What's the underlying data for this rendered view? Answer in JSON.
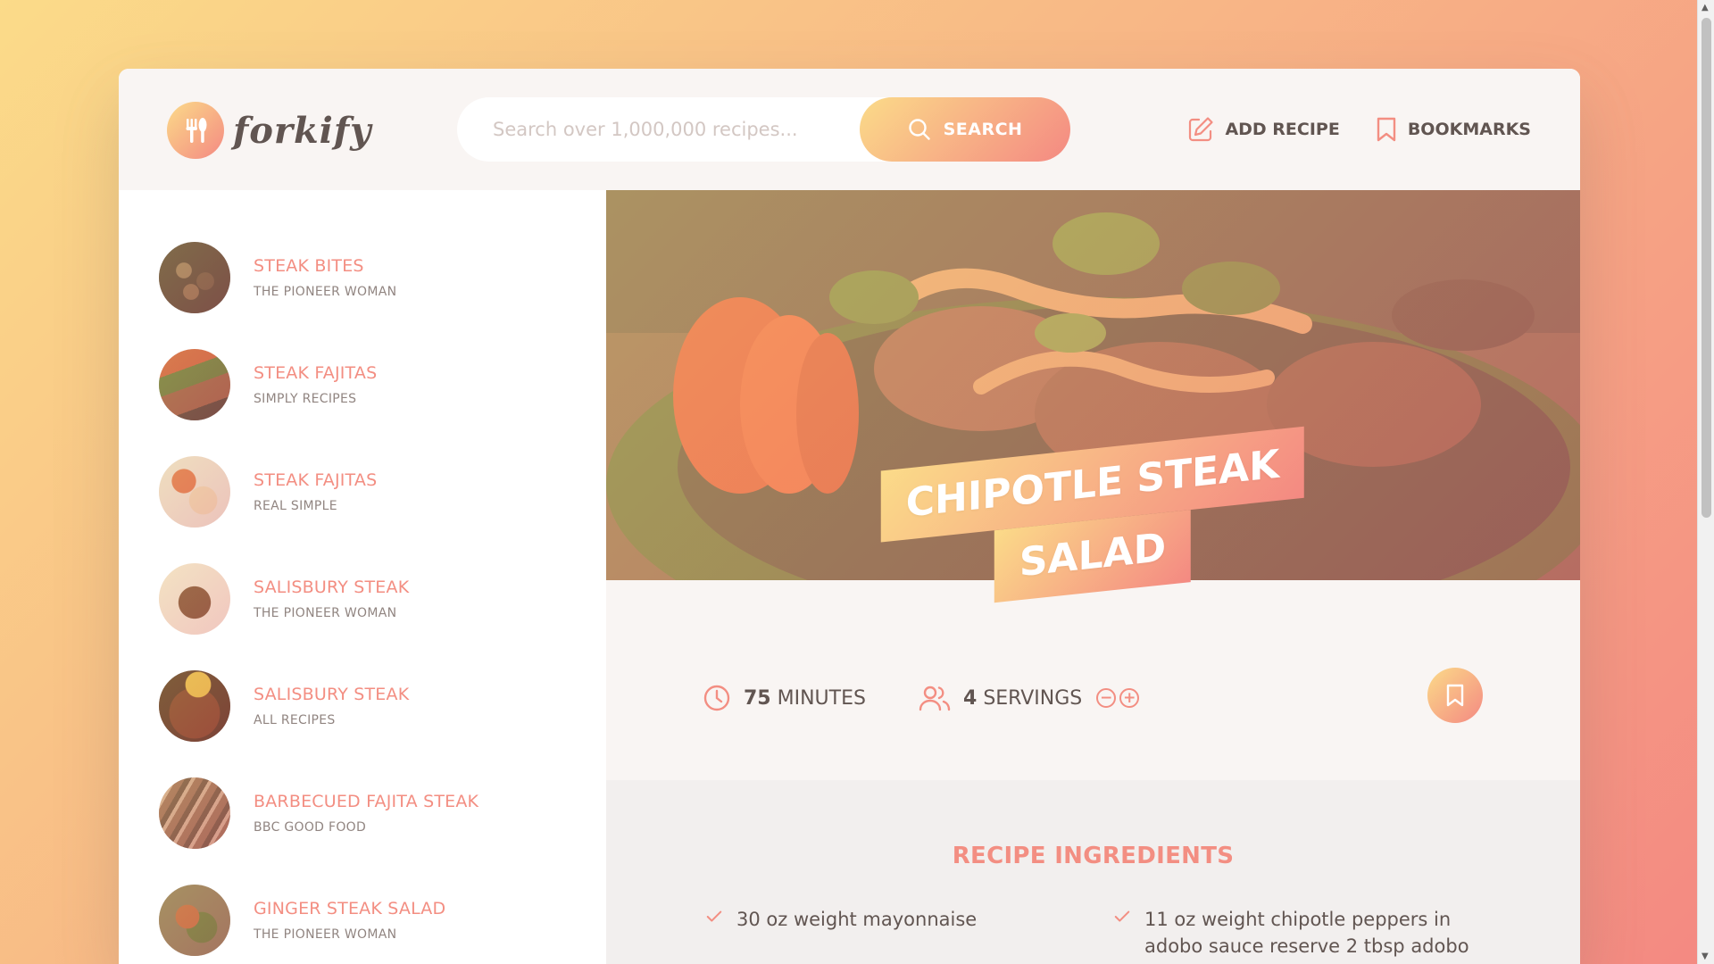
{
  "app": {
    "logo_text": "forkify",
    "search": {
      "placeholder": "Search over 1,000,000 recipes...",
      "button_label": "SEARCH"
    },
    "nav": {
      "add_recipe": "ADD RECIPE",
      "bookmarks": "BOOKMARKS"
    }
  },
  "results": [
    {
      "title": "STEAK BITES",
      "publisher": "THE PIONEER WOMAN",
      "thumb": "steak-bites"
    },
    {
      "title": "STEAK FAJITAS",
      "publisher": "SIMPLY RECIPES",
      "thumb": "steak-fajitas"
    },
    {
      "title": "STEAK FAJITAS",
      "publisher": "REAL SIMPLE",
      "thumb": "steak-fajitas-plate"
    },
    {
      "title": "SALISBURY STEAK",
      "publisher": "THE PIONEER WOMAN",
      "thumb": "salisbury-steak"
    },
    {
      "title": "SALISBURY STEAK",
      "publisher": "ALL RECIPES",
      "thumb": "salisbury-steak-gravy"
    },
    {
      "title": "BARBECUED FAJITA STEAK",
      "publisher": "BBC GOOD FOOD",
      "thumb": "fajita-steak"
    },
    {
      "title": "GINGER STEAK SALAD",
      "publisher": "THE PIONEER WOMAN",
      "thumb": "ginger-steak-salad"
    }
  ],
  "recipe": {
    "title_line1": "CHIPOTLE STEAK",
    "title_line2": "SALAD",
    "cooking_time": "75",
    "cooking_time_unit": "MINUTES",
    "servings": "4",
    "servings_unit": "SERVINGS",
    "ingredients_heading": "RECIPE INGREDIENTS",
    "ingredients": [
      "30 oz weight mayonnaise",
      "11 oz weight chipotle peppers in adobo sauce reserve 2 tbsp adobo"
    ]
  },
  "colors": {
    "accent": "#f38e82",
    "gradient_start": "#fbdb89",
    "gradient_end": "#f48982",
    "text": "#615551",
    "header_bg": "#f9f5f3"
  },
  "icons": {
    "logo": "fork-knife-icon",
    "search": "search-icon",
    "add_recipe": "edit-icon",
    "bookmarks": "bookmark-icon",
    "time": "clock-icon",
    "servings": "users-icon",
    "decrease": "minus-circle-icon",
    "increase": "plus-circle-icon",
    "check": "check-icon"
  }
}
